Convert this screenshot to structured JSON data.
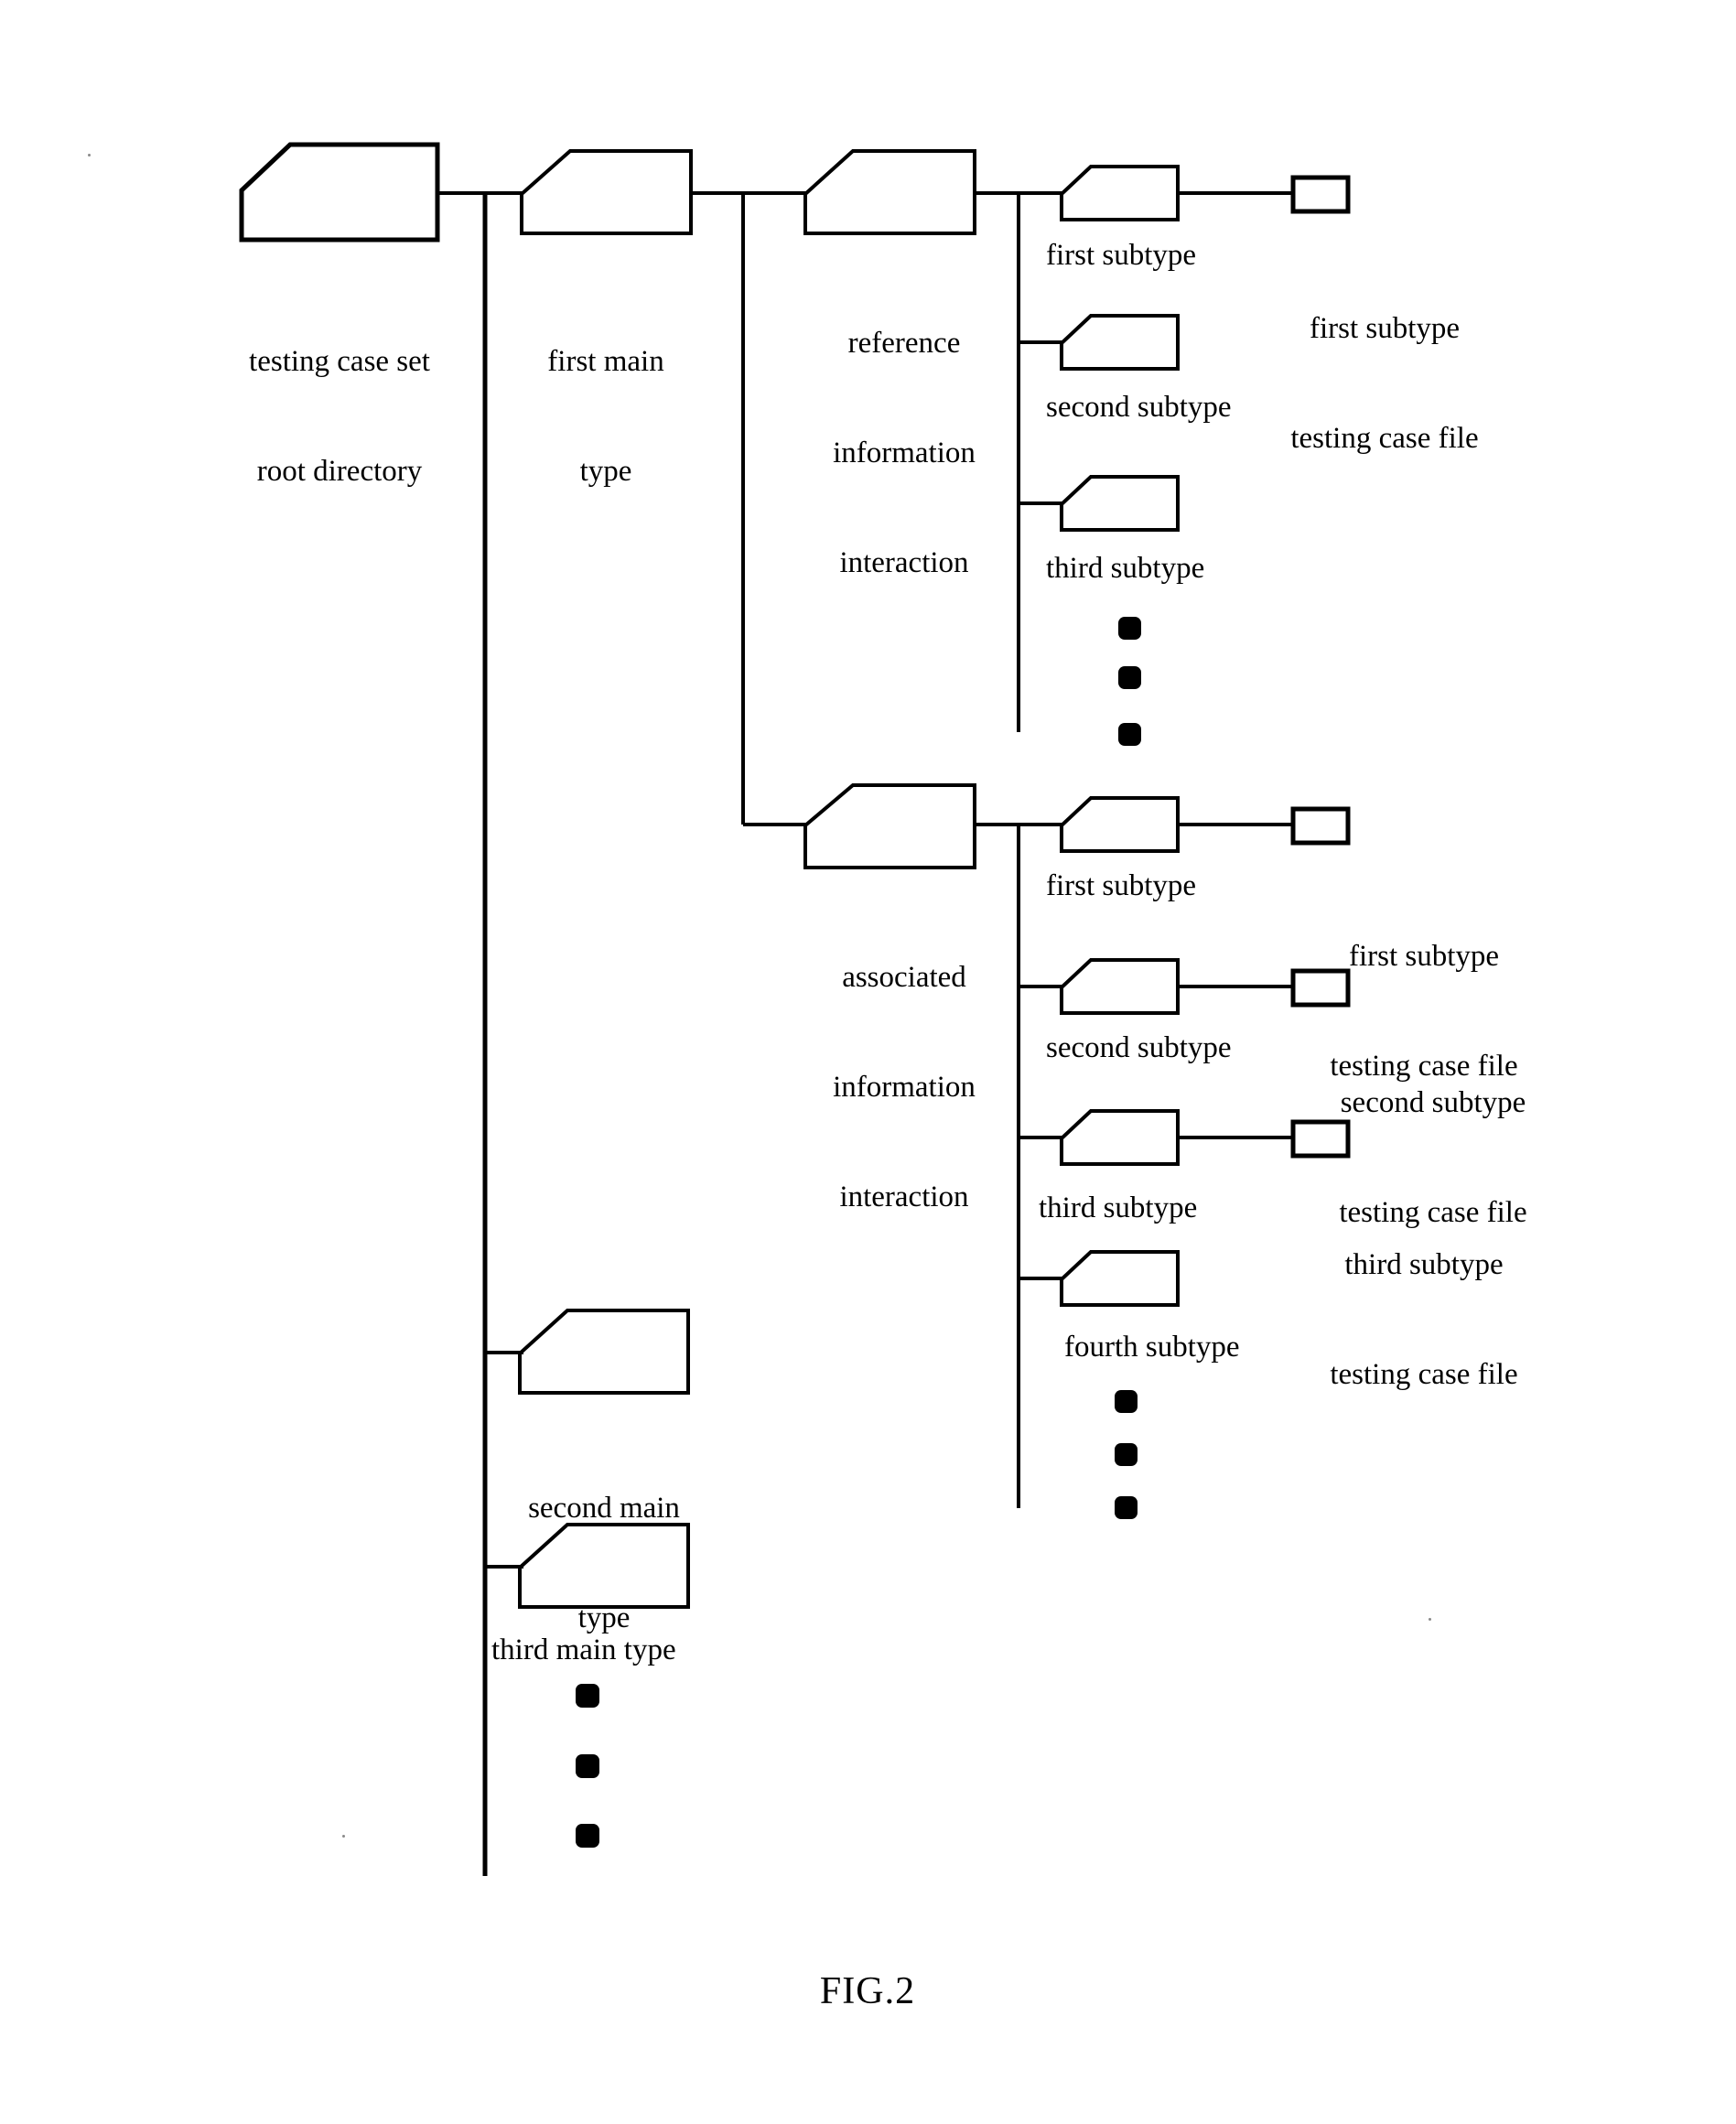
{
  "figure": {
    "caption": "FIG.2",
    "title": "testing case set directory tree structure"
  },
  "colors": {
    "stroke": "#000000",
    "background": "#ffffff",
    "dot": "#000000"
  },
  "nodes": {
    "root": {
      "label_line1": "testing case set",
      "label_line2": "root directory",
      "icon": "folder-icon"
    },
    "first_main_type": {
      "label_line1": "first main",
      "label_line2": "type",
      "icon": "folder-icon"
    },
    "second_main_type": {
      "label_line1": "second main",
      "label_line2": "type",
      "icon": "folder-icon"
    },
    "third_main_type": {
      "label_line1": "third main type",
      "label_line2": "",
      "icon": "folder-icon"
    },
    "reference_information_interaction": {
      "label_line1": "reference",
      "label_line2": "information",
      "label_line3": "interaction",
      "icon": "folder-icon"
    },
    "associated_information_interaction": {
      "label_line1": "associated",
      "label_line2": "information",
      "label_line3": "interaction",
      "icon": "folder-icon"
    }
  },
  "reference_subtypes": [
    {
      "label": "first subtype",
      "icon": "folder-icon",
      "file": {
        "label_line1": "first subtype",
        "label_line2": "testing case file",
        "icon": "file-icon"
      }
    },
    {
      "label": "second subtype",
      "icon": "folder-icon",
      "file": null
    },
    {
      "label": "third subtype",
      "icon": "folder-icon",
      "file": null
    }
  ],
  "associated_subtypes": [
    {
      "label": "first subtype",
      "icon": "folder-icon",
      "file": {
        "label_line1": "first subtype",
        "label_line2": "testing case file",
        "icon": "file-icon"
      }
    },
    {
      "label": "second subtype",
      "icon": "folder-icon",
      "file": {
        "label_line1": "second subtype",
        "label_line2": "testing case file",
        "icon": "file-icon"
      }
    },
    {
      "label": "third subtype",
      "icon": "folder-icon",
      "file": {
        "label_line1": "third subtype",
        "label_line2": "testing case file",
        "icon": "file-icon"
      }
    },
    {
      "label": "fourth subtype",
      "icon": "folder-icon",
      "file": null
    }
  ],
  "ellipses": [
    {
      "name": "reference-subtype-ellipsis",
      "dots": 3
    },
    {
      "name": "associated-subtype-ellipsis",
      "dots": 3
    },
    {
      "name": "main-type-ellipsis",
      "dots": 3
    }
  ]
}
